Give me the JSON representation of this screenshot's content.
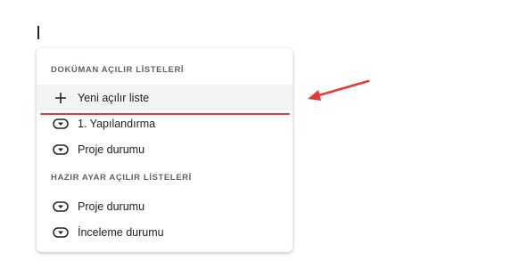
{
  "menu": {
    "document_section_header": "DOKÜMAN AÇILIR LİSTELERİ",
    "document_items": [
      {
        "label": "Yeni açılır liste",
        "icon": "plus-icon"
      },
      {
        "label": "1. Yapılandırma",
        "icon": "dropdown-chip-icon"
      },
      {
        "label": "Proje durumu",
        "icon": "dropdown-chip-icon"
      }
    ],
    "preset_section_header": "HAZIR AYAR AÇILIR LİSTELERİ",
    "preset_items": [
      {
        "label": "Proje durumu",
        "icon": "dropdown-chip-icon"
      },
      {
        "label": "İnceleme durumu",
        "icon": "dropdown-chip-icon"
      }
    ]
  },
  "colors": {
    "annotation": "#e53935",
    "highlight": "#f1f3f4",
    "text": "#202124",
    "header_text": "#5f6368"
  }
}
